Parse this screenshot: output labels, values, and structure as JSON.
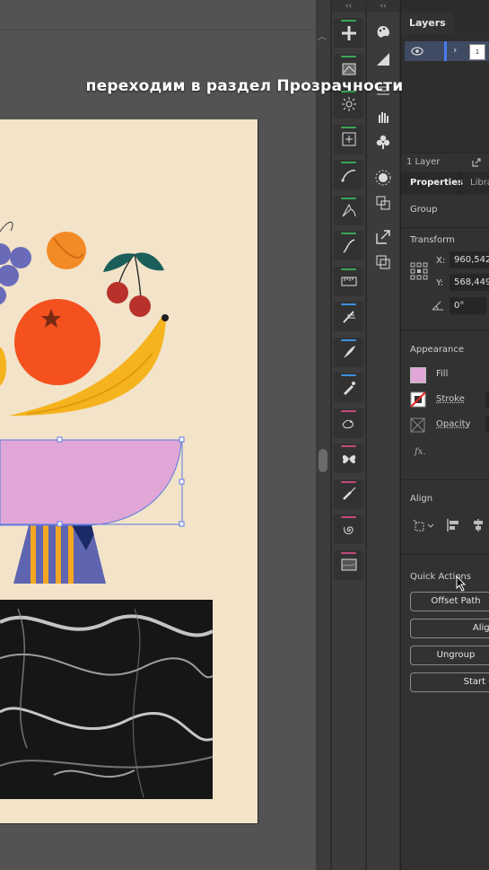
{
  "caption": "переходим в раздел Прозрачности",
  "colors": {
    "accent_selection": "#5c79e0",
    "bowl_fill": "#e0a7d6",
    "orange": "#f4511e",
    "banana": "#f5b31e",
    "grape": "#6a6bb8",
    "cherry": "#b8312a",
    "leaf": "#1b5e5a",
    "artboard": "#f2e3c9"
  },
  "column_collapse": [
    "‹‹",
    "‹‹"
  ],
  "tools_col1": [
    {
      "name": "add-anchor-icon",
      "bar": "#3aa657"
    },
    {
      "name": "crop-image-icon",
      "bar": "#3aa657"
    },
    {
      "name": "sunburst-icon",
      "bar": "#3aa657"
    },
    {
      "name": "transform-box-icon",
      "bar": "#3aa657"
    },
    {
      "name": "curvature-icon",
      "bar": "#3aa657"
    },
    {
      "name": "anchor-point-icon",
      "bar": "#3aa657"
    },
    {
      "name": "width-curve-icon",
      "bar": "#3aa657"
    },
    {
      "name": "ruler-icon",
      "bar": "#3aa657"
    },
    {
      "name": "pencil-lines-icon",
      "bar": "#3d8fe0"
    },
    {
      "name": "quill-pen-icon",
      "bar": "#3d8fe0"
    },
    {
      "name": "eyedropper-pen-icon",
      "bar": "#3d8fe0"
    },
    {
      "name": "bird-icon",
      "bar": "#c2487b"
    },
    {
      "name": "butterfly-icon",
      "bar": "#c2487b"
    },
    {
      "name": "brush-pen-icon",
      "bar": "#c2487b"
    },
    {
      "name": "spiral-icon",
      "bar": "#c2487b"
    },
    {
      "name": "texture-icon",
      "bar": "#c2487b"
    }
  ],
  "tools_col2": [
    "palette-icon",
    "gradient-icon",
    "lines-icon",
    "hand-icon",
    "club-icon",
    "sun-icon",
    "artboards-icon",
    "export-icon",
    "stack-icon"
  ],
  "layers": {
    "tab": "Layers",
    "row_thumb": "1",
    "footer_count": "1 Layer"
  },
  "properties": {
    "tab_active": "Properties",
    "tab_other": "Libra",
    "selection_type": "Group",
    "transform_title": "Transform",
    "x_label": "X:",
    "x_value": "960,542",
    "y_label": "Y:",
    "y_value": "568,449",
    "angle_value": "0°",
    "appearance_title": "Appearance",
    "fill_label": "Fill",
    "stroke_label": "Stroke",
    "opacity_label": "Opacity",
    "fx_label": "fx.",
    "align_title": "Align",
    "quick_actions_title": "Quick Actions",
    "qa_buttons": [
      "Offset Path",
      "Align",
      "Ungroup",
      "Start G"
    ]
  }
}
